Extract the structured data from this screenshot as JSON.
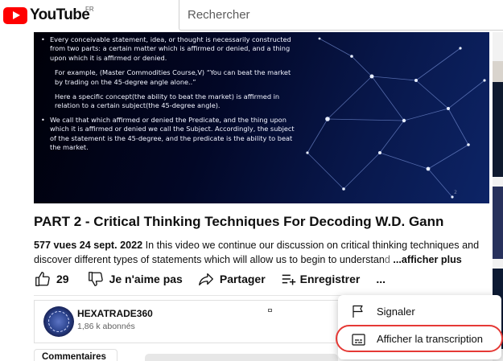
{
  "header": {
    "logo_text": "YouTube",
    "country": "FR",
    "search_placeholder": "Rechercher"
  },
  "video": {
    "slide": {
      "bullet1": "Every conceivable statement, idea, or thought is necessarily constructed from two parts: a certain matter which is affirmed or denied, and a thing upon which it is affirmed or denied.",
      "example": "For example, (Master Commodities Course,V) “You can beat the market by trading on the 45-degree angle alone..”",
      "concept": "Here a specific concept(the ability to beat the market) is affirmed in relation to a certain subject(the 45-degree angle).",
      "bullet2": "We call that which affirmed or denied the Predicate, and the thing upon which it is affirmed or denied we call the Subject. Accordingly, the subject of the statement is the 45-degree, and the predicate is the ability to beat the market.",
      "page_number": "2"
    }
  },
  "title": "PART 2 - Critical Thinking Techniques For Decoding W.D. Gann",
  "description": {
    "meta": "577 vues  24 sept. 2022",
    "text": "In this video we continue our discussion on critical thinking techniques and discover different types of statements which will allow us to begin to understan",
    "faded": "d",
    "more": "...afficher plus"
  },
  "actions": {
    "like_count": "29",
    "dislike_label": "Je n'aime pas",
    "share_label": "Partager",
    "save_label": "Enregistrer",
    "more_label": "..."
  },
  "channel": {
    "name": "HEXATRADE360",
    "subscribers": "1,86 k abonnés"
  },
  "comments": {
    "label": "Commentaires"
  },
  "menu": {
    "items": [
      {
        "label": "Signaler",
        "icon": "flag-icon"
      },
      {
        "label": "Afficher la transcription",
        "icon": "transcript-icon"
      }
    ]
  },
  "colors": {
    "brand": "#ff0000",
    "highlight_oval": "#e53935"
  }
}
